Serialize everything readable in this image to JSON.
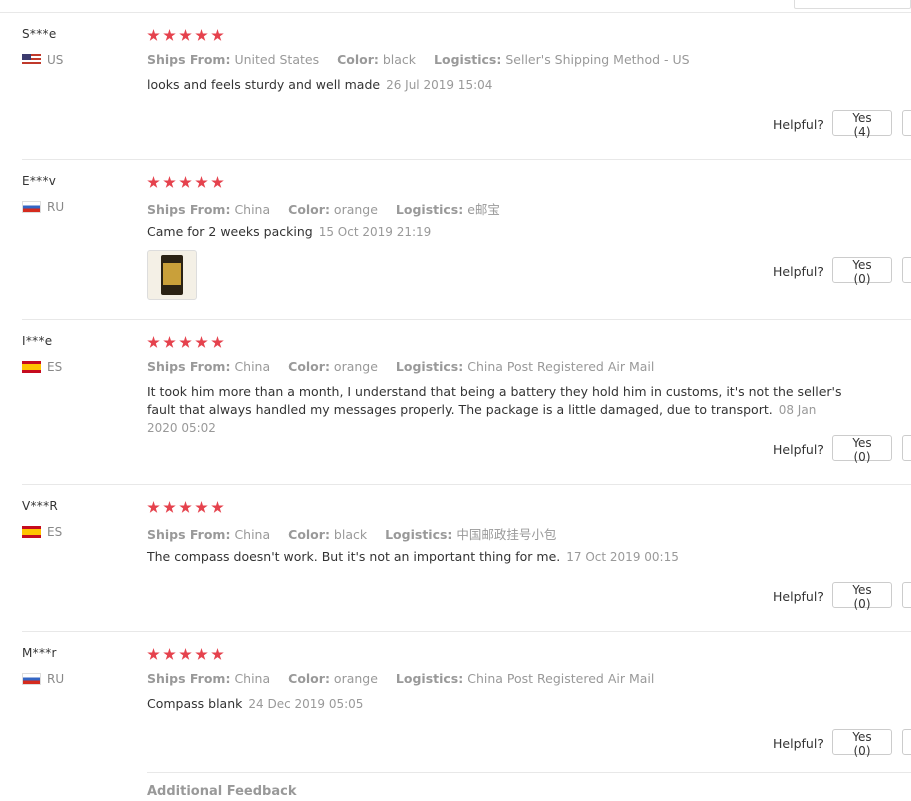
{
  "reviews": [
    {
      "name": "S***e",
      "country": "US",
      "ships_label": "Ships From:",
      "ships": "United States",
      "color_label": "Color:",
      "color": "black",
      "logistics_label": "Logistics:",
      "logistics": "Seller's Shipping Method - US",
      "text": "looks and feels sturdy and well made",
      "date": "26 Jul 2019 15:04",
      "helpful_label": "Helpful?",
      "yes_label": "Yes (4)",
      "rating": 5
    },
    {
      "name": "E***v",
      "country": "RU",
      "ships_label": "Ships From:",
      "ships": "China",
      "color_label": "Color:",
      "color": "orange",
      "logistics_label": "Logistics:",
      "logistics": "e邮宝",
      "text": "Came for 2 weeks packing",
      "date": "15 Oct 2019 21:19",
      "helpful_label": "Helpful?",
      "yes_label": "Yes (0)",
      "rating": 5
    },
    {
      "name": "I***e",
      "country": "ES",
      "ships_label": "Ships From:",
      "ships": "China",
      "color_label": "Color:",
      "color": "orange",
      "logistics_label": "Logistics:",
      "logistics": "China Post Registered Air Mail",
      "text": "It took him more than a month, I understand that being a battery they hold him in customs, it's not the seller's fault that always handled my messages properly. The package is a little damaged, due to transport.",
      "date": "08 Jan 2020 05:02",
      "helpful_label": "Helpful?",
      "yes_label": "Yes (0)",
      "rating": 5
    },
    {
      "name": "V***R",
      "country": "ES",
      "ships_label": "Ships From:",
      "ships": "China",
      "color_label": "Color:",
      "color": "black",
      "logistics_label": "Logistics:",
      "logistics": "中国邮政挂号小包",
      "text": "The compass doesn't work. But it's not an important thing for me.",
      "date": "17 Oct 2019 00:15",
      "helpful_label": "Helpful?",
      "yes_label": "Yes (0)",
      "rating": 5
    },
    {
      "name": "M***r",
      "country": "RU",
      "ships_label": "Ships From:",
      "ships": "China",
      "color_label": "Color:",
      "color": "orange",
      "logistics_label": "Logistics:",
      "logistics": "China Post Registered Air Mail",
      "text": "Compass blank",
      "date": "24 Dec 2019 05:05",
      "helpful_label": "Helpful?",
      "yes_label": "Yes (0)",
      "rating": 5
    }
  ],
  "additional_feedback": "Additional Feedback",
  "star_color": "#e5424d"
}
